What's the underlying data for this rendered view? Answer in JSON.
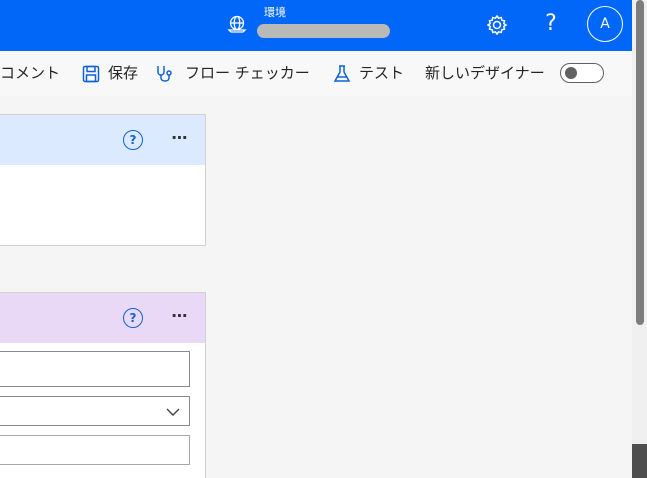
{
  "header": {
    "environment_label": "環境",
    "help_label": "?",
    "avatar_initial": "A",
    "icons": {
      "environment": "globe-icon",
      "settings": "gear-icon"
    },
    "colors": {
      "background": "#0067f9",
      "foreground": "#ffffff"
    }
  },
  "toolbar": {
    "comment_label": "コメント",
    "save_label": "保存",
    "flow_checker_label": "フロー チェッカー",
    "test_label": "テスト",
    "new_designer_label": "新しいデザイナー",
    "new_designer_toggle": "off",
    "icons": {
      "save": "save-icon",
      "flow_checker": "stethoscope-icon",
      "test": "flask-icon"
    }
  },
  "canvas": {
    "cards": [
      {
        "header_color": "#dbeaff",
        "help_icon": "?",
        "menu": "⋯"
      },
      {
        "header_color": "#ead9f6",
        "help_icon": "?",
        "menu": "⋯",
        "fields": [
          "text",
          "dropdown",
          "text"
        ]
      }
    ]
  },
  "accent_color": "#0f62d6"
}
